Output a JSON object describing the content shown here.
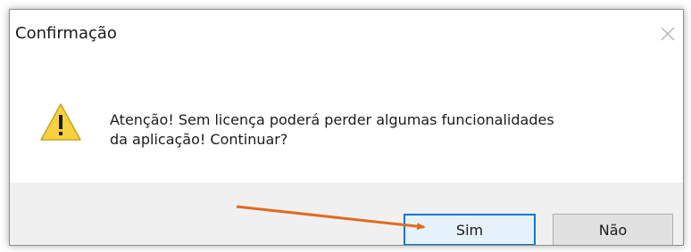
{
  "dialog": {
    "title": "Confirmação",
    "message_line1": "Atenção! Sem licença poderá perder algumas funcionalidades",
    "message_line2": "da aplicação! Continuar?",
    "icon": "warning-icon",
    "close_icon": "close-icon"
  },
  "buttons": {
    "yes_label": "Sim",
    "no_label": "Não",
    "default": "yes"
  },
  "annotation": {
    "arrow_color": "#e06b1f",
    "points_to": "yes-button"
  },
  "colors": {
    "accent": "#0078d7",
    "footer_bg": "#f0f0f0",
    "warning_yellow": "#f7d23e"
  }
}
